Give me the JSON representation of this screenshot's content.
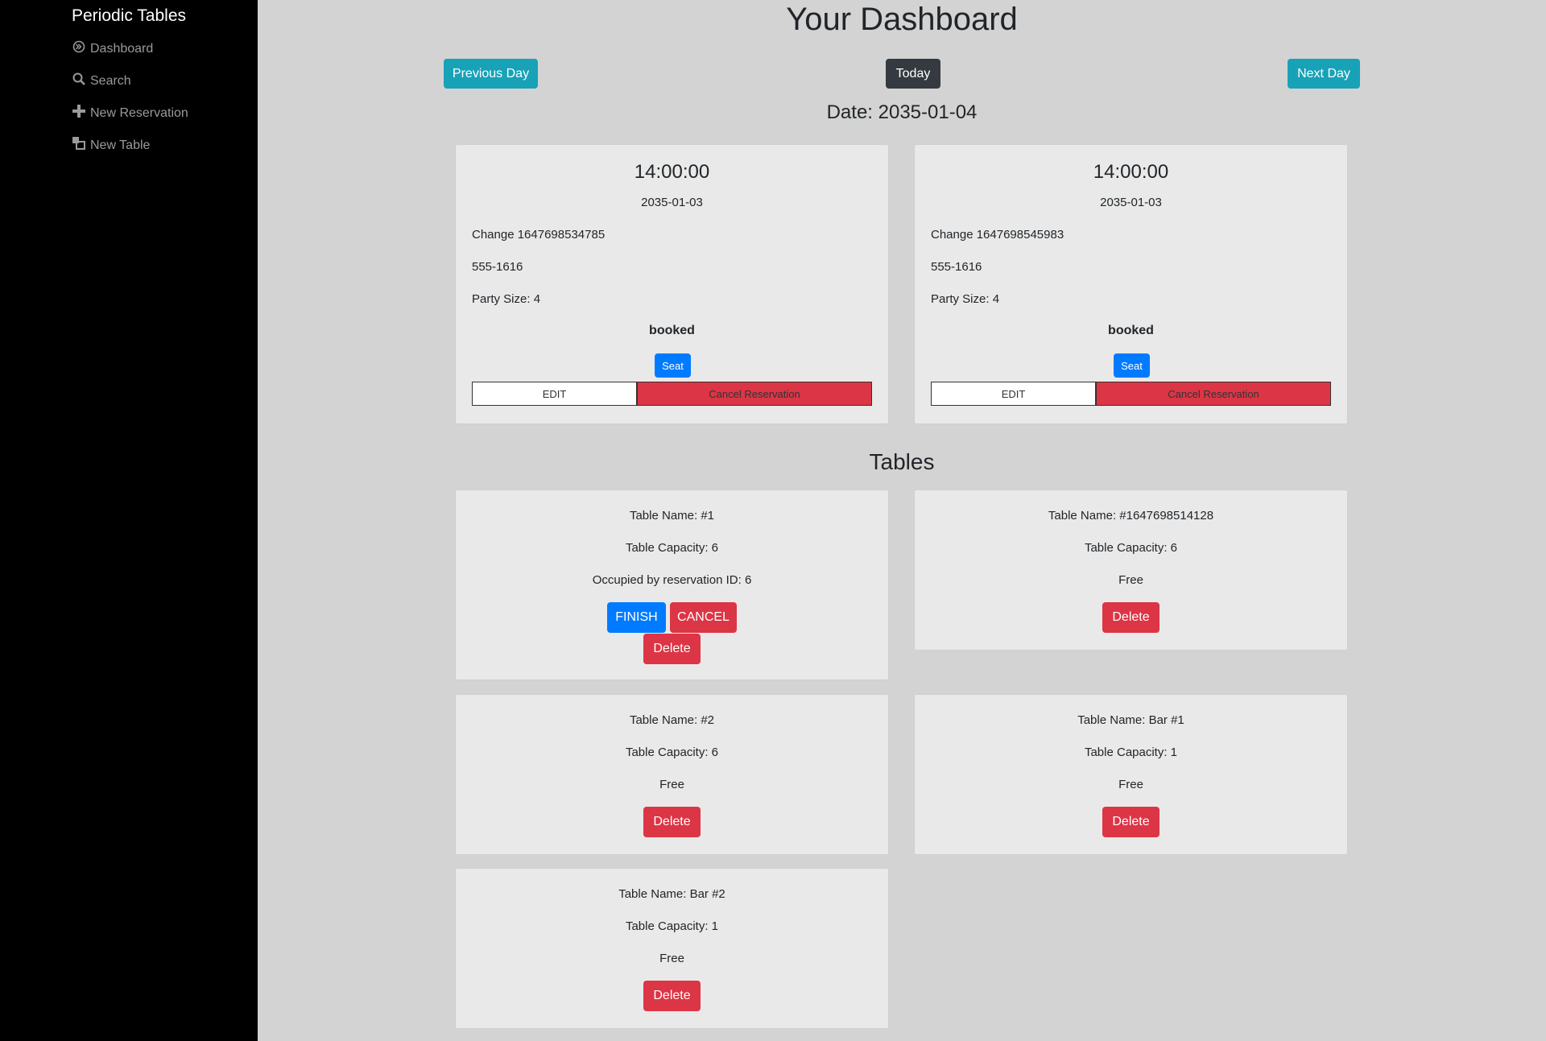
{
  "sidebar": {
    "brand": "Periodic Tables",
    "items": [
      {
        "label": "Dashboard",
        "icon": "dashboard-icon"
      },
      {
        "label": "Search",
        "icon": "search-icon"
      },
      {
        "label": "New Reservation",
        "icon": "plus-icon"
      },
      {
        "label": "New Table",
        "icon": "new-table-icon"
      }
    ]
  },
  "main": {
    "title": "Your Dashboard",
    "prev_label": "Previous Day",
    "today_label": "Today",
    "next_label": "Next Day",
    "date_text": "Date: 2035-01-04",
    "tables_title": "Tables"
  },
  "reservations": [
    {
      "time": "14:00:00",
      "date": "2035-01-03",
      "name": "Change 1647698534785",
      "phone": "555-1616",
      "party": "Party Size: 4",
      "status": "booked",
      "seat_label": "Seat",
      "edit_label": "EDIT",
      "cancel_label": "Cancel Reservation"
    },
    {
      "time": "14:00:00",
      "date": "2035-01-03",
      "name": "Change 1647698545983",
      "phone": "555-1616",
      "party": "Party Size: 4",
      "status": "booked",
      "seat_label": "Seat",
      "edit_label": "EDIT",
      "cancel_label": "Cancel Reservation"
    }
  ],
  "tables": [
    {
      "name": "Table Name: #1",
      "capacity": "Table Capacity: 6",
      "status": "Occupied by reservation ID: 6",
      "finish_label": "FINISH",
      "cancel_label": "CANCEL",
      "delete_label": "Delete"
    },
    {
      "name": "Table Name: #1647698514128",
      "capacity": "Table Capacity: 6",
      "status": "Free",
      "delete_label": "Delete"
    },
    {
      "name": "Table Name: #2",
      "capacity": "Table Capacity: 6",
      "status": "Free",
      "delete_label": "Delete"
    },
    {
      "name": "Table Name: Bar #1",
      "capacity": "Table Capacity: 1",
      "status": "Free",
      "delete_label": "Delete"
    },
    {
      "name": "Table Name: Bar #2",
      "capacity": "Table Capacity: 1",
      "status": "Free",
      "delete_label": "Delete"
    }
  ],
  "colors": {
    "sidebar_bg": "#000000",
    "page_bg": "#d3d3d3",
    "card_bg": "#e9e9e9",
    "info": "#17a2b8",
    "primary": "#007bff",
    "danger": "#dc3545",
    "dark": "#343a40"
  }
}
